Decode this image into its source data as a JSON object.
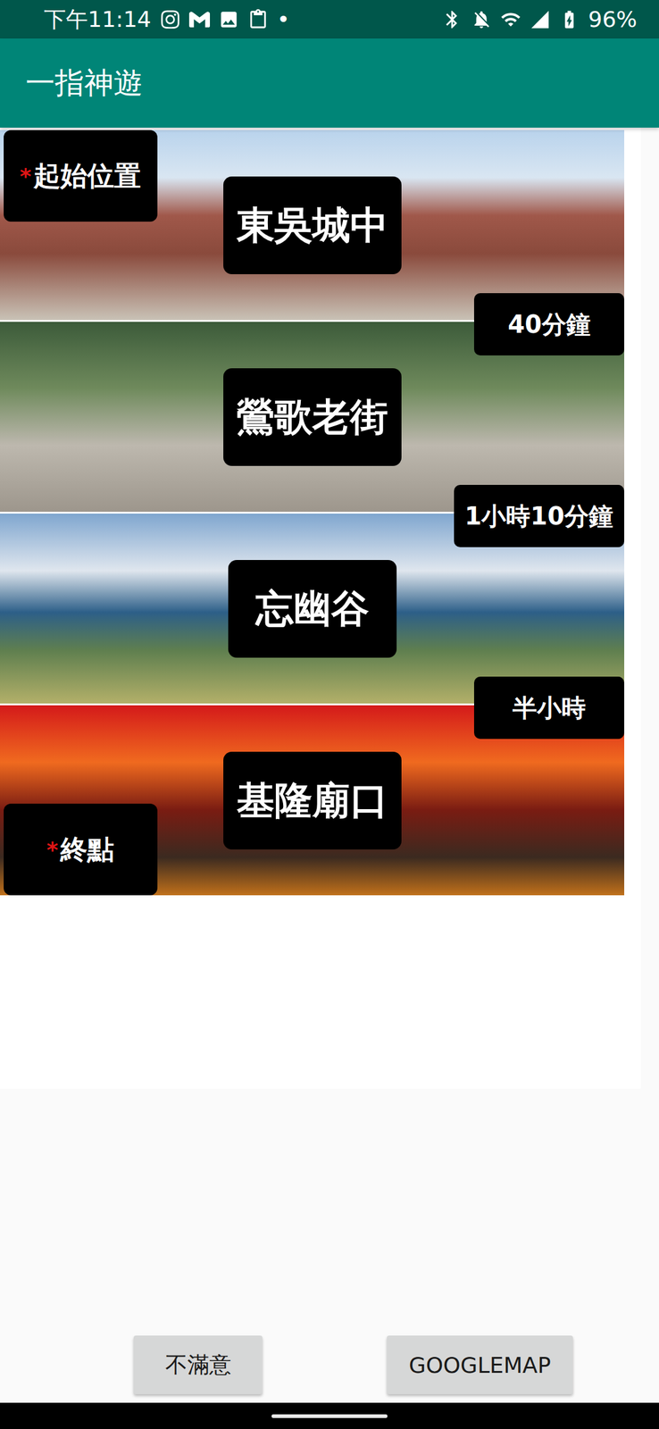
{
  "status_bar": {
    "time": "下午11:14",
    "dot": "•",
    "battery": "96%"
  },
  "app_bar": {
    "title": "一指神遊"
  },
  "itinerary": {
    "stops": [
      {
        "name": "東吳城中",
        "marker": {
          "kind": "start",
          "mark": "*",
          "text": "起始位置"
        },
        "travel": "40分鐘"
      },
      {
        "name": "鶯歌老街",
        "travel": "1小時10分鐘"
      },
      {
        "name": "忘幽谷",
        "travel": "半小時"
      },
      {
        "name": "基隆廟口",
        "marker": {
          "kind": "end",
          "mark": "*",
          "text": "終點"
        }
      }
    ]
  },
  "buttons": [
    {
      "label": "不滿意"
    },
    {
      "label": "GOOGLEMAP"
    }
  ]
}
